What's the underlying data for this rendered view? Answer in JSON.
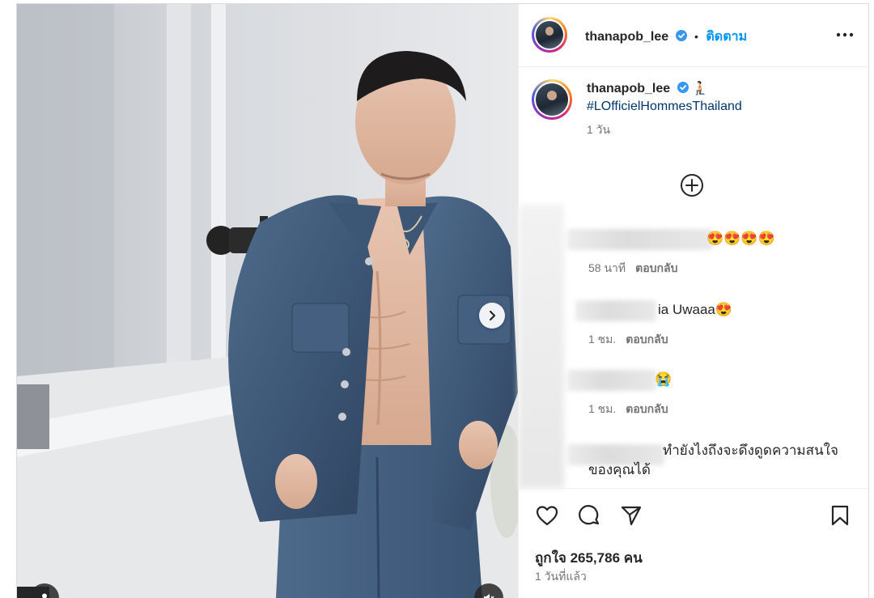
{
  "post": {
    "username": "thanapob_lee",
    "follow_label": "ติดตาม",
    "separator": "•",
    "caption_emoji": "🧎🏻",
    "caption_hashtag": "#LOfficielHommesThailand",
    "caption_time": "1 วัน",
    "likes_label": "ถูกใจ 265,786 คน",
    "posted_ago": "1 วันที่แล้ว"
  },
  "comments": [
    {
      "text": "😍😍😍😍",
      "time": "58 นาที",
      "reply": "ตอบกลับ"
    },
    {
      "text": "ia Uwaaa😍",
      "time": "1 ชม.",
      "reply": "ตอบกลับ"
    },
    {
      "text": "😭",
      "time": "1 ชม.",
      "reply": "ตอบกลับ"
    },
    {
      "text": "ทำยังไงถึงจะดึงดูดความสนใจ ของคุณได้"
    }
  ],
  "icons": {
    "verified": "verified-badge-icon",
    "more": "more-options-icon",
    "next": "chevron-right-icon",
    "expand": "plus-circle-icon",
    "like": "heart-icon",
    "comment": "comment-icon",
    "share": "send-icon",
    "save": "bookmark-icon",
    "mute": "muted-speaker-icon",
    "tag": "person-tag-icon"
  },
  "colors": {
    "accent": "#0095f6",
    "hashtag": "#00376b",
    "muted_text": "#737373",
    "verified": "#3897f0"
  }
}
